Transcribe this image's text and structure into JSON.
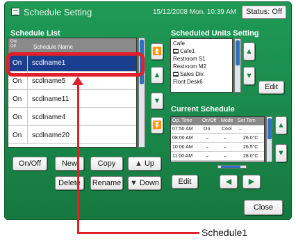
{
  "window": {
    "title": "Schedule Setting",
    "datetime": "15/12/2008 Mon. 10:39 AM",
    "status_label": "Status: Off"
  },
  "schedule_list": {
    "label": "Schedule List",
    "header_onoff": "On/ Off",
    "header_name": "Schedule Name",
    "rows": [
      {
        "onoff": "On",
        "name": "scdlname1",
        "selected": true
      },
      {
        "onoff": "On",
        "name": "scdlname5"
      },
      {
        "onoff": "On",
        "name": "scdlname11"
      },
      {
        "onoff": "On",
        "name": "scdlname4"
      },
      {
        "onoff": "On",
        "name": "scdlname20"
      }
    ],
    "buttons": {
      "onoff": "On/Off",
      "new": "New",
      "copy": "Copy",
      "up": "Up",
      "delete": "Delete",
      "rename": "Rename",
      "down": "Down"
    }
  },
  "units": {
    "label": "Scheduled Units Setting",
    "items": [
      "Cafe",
      "Cafe1",
      "Restroom S1",
      "Restroom M2",
      "Sales Div.",
      "Flont Desk6"
    ],
    "edit": "Edit"
  },
  "current_schedule": {
    "label": "Current Schedule",
    "headers": [
      "Op. Time",
      "On/Off",
      "Mode",
      "Set Tem"
    ],
    "rows": [
      [
        "07:50 AM",
        "On",
        "Cool",
        "–"
      ],
      [
        "08:00 AM",
        "–",
        "–",
        "26.0°C"
      ],
      [
        "10:00 AM",
        "–",
        "–",
        "26.5°C"
      ],
      [
        "11:00 AM",
        "–",
        "–",
        "28.0°C"
      ]
    ],
    "edit": "Edit"
  },
  "close": "Close",
  "annotation": "Schedule1",
  "colors": {
    "panel_green": "#1a8a4c",
    "selected_row": "#1b3f8f",
    "annotation_red": "#e0202a"
  }
}
